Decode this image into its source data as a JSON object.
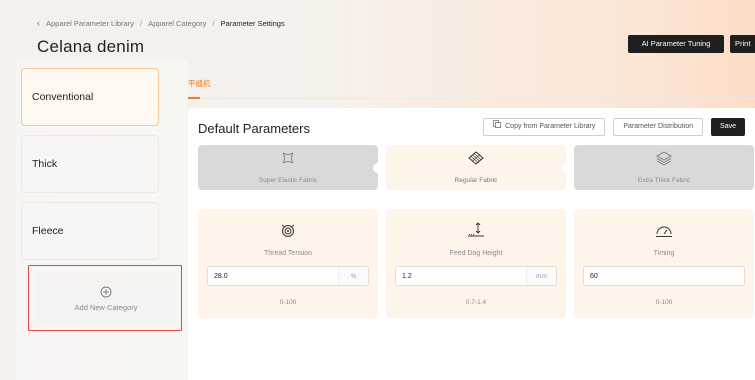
{
  "breadcrumb": {
    "items": [
      "Apparel Parameter Library",
      "Apparel Category",
      "Parameter Settings"
    ],
    "separator": "/"
  },
  "page": {
    "title": "Celana denim"
  },
  "top_actions": {
    "ai_tuning": "AI Parameter Tuning",
    "print": "Print"
  },
  "sidebar": {
    "categories": [
      {
        "label": "Conventional",
        "active": true
      },
      {
        "label": "Thick",
        "active": false
      },
      {
        "label": "Fleece",
        "active": false
      }
    ],
    "add_label": "Add New Category",
    "add_icon": "plus-circle-icon"
  },
  "tabs": [
    {
      "label": "平缝机",
      "active": true
    }
  ],
  "panel": {
    "title": "Default Parameters",
    "copy_label": "Copy from Parameter Library",
    "distribution_label": "Parameter Distribution",
    "save_label": "Save"
  },
  "fabrics": [
    {
      "label": "Super Elastic Fabric",
      "icon": "elastic-fabric-icon",
      "selected": false
    },
    {
      "label": "Regular Fabric",
      "icon": "regular-fabric-icon",
      "selected": true
    },
    {
      "label": "Extra Thick Fabric",
      "icon": "thick-fabric-icon",
      "selected": false
    }
  ],
  "params": [
    {
      "label": "Thread Tension",
      "value": "28.0",
      "unit": "%",
      "range": "0-100",
      "icon": "thread-tension-icon"
    },
    {
      "label": "Feed Dog Height",
      "value": "1.2",
      "unit": "mm",
      "range": "0.7-1.4",
      "icon": "feed-dog-height-icon"
    },
    {
      "label": "Timing",
      "value": "60",
      "unit": "",
      "range": "0-100",
      "icon": "timing-gauge-icon"
    }
  ],
  "colors": {
    "accent": "#ee7b27",
    "highlight_border": "#e8453c",
    "dark_button": "#1f1f1f"
  }
}
